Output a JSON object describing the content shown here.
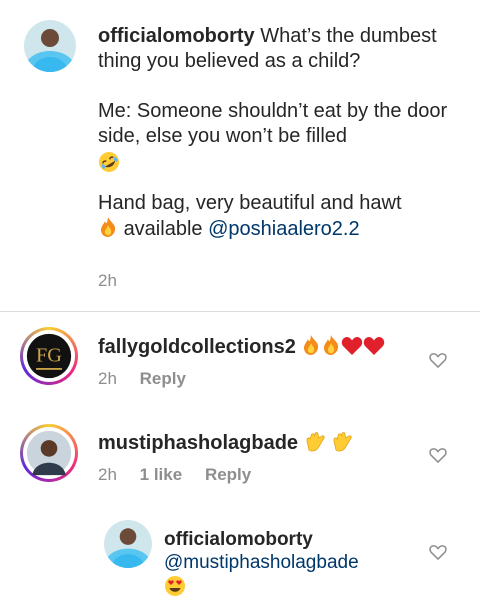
{
  "caption": {
    "username": "officialomoborty",
    "line1_text": "What’s the dumbest thing you believed as a child?",
    "para2": "Me: Someone shouldn’t eat by the door side, else you won’t be filled",
    "para3_a": "Hand bag, very beautiful and hawt",
    "para3_b": "available",
    "mention": "@poshiaalero2.2",
    "time": "2h"
  },
  "comments": [
    {
      "username": "fallygoldcollections2",
      "time": "2h",
      "reply_label": "Reply",
      "emojis": [
        "fire-emoji",
        "fire-emoji",
        "red-heart-emoji",
        "red-heart-emoji"
      ]
    },
    {
      "username": "mustiphasholagbade",
      "time": "2h",
      "likes": "1 like",
      "reply_label": "Reply",
      "emojis": [
        "clapping-hands-emoji",
        "clapping-hands-emoji"
      ]
    },
    {
      "username": "officialomoborty",
      "mention": "@mustiphasholagbade",
      "emojis": [
        "heart-eyes-emoji"
      ]
    }
  ],
  "colors": {
    "mention": "#00376b",
    "meta": "#8e8e8e",
    "divider": "#dbdbdb"
  }
}
